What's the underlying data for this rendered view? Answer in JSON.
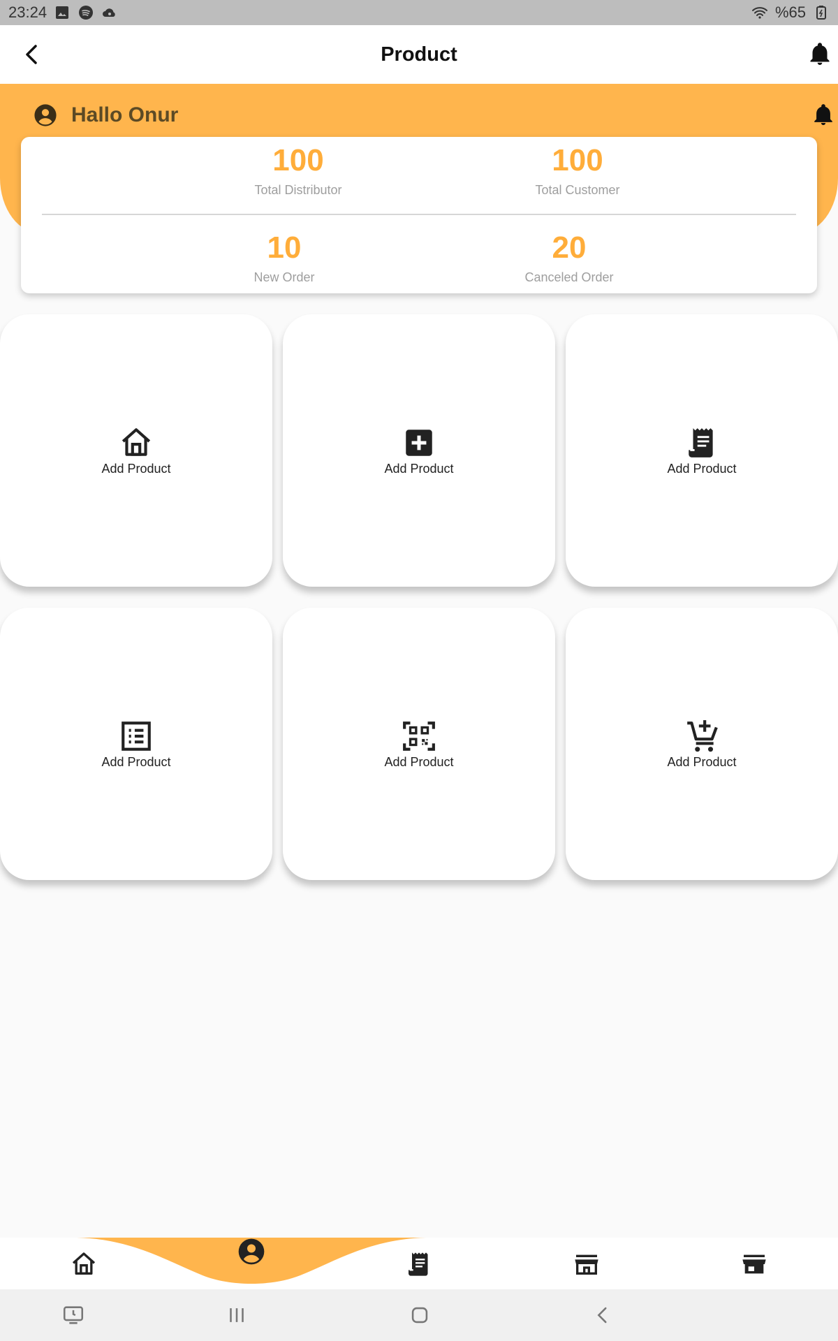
{
  "status_bar": {
    "time": "23:24",
    "battery": "%65",
    "icons": [
      "gallery-icon",
      "spotify-icon",
      "cloud-icon",
      "wifi-icon",
      "battery-icon"
    ]
  },
  "app_bar": {
    "title": "Product",
    "back_icon": "back-arrow-icon",
    "bell_icon": "bell-icon"
  },
  "header": {
    "greeting": "Hallo Onur",
    "avatar_icon": "account-circle-icon",
    "bell_icon": "bell-icon",
    "color": "#ffb54d"
  },
  "stats": [
    {
      "value": "100",
      "label": "Total Distributor"
    },
    {
      "value": "100",
      "label": "Total Customer"
    },
    {
      "value": "10",
      "label": "New Order"
    },
    {
      "value": "20",
      "label": "Canceled Order"
    }
  ],
  "tiles": [
    {
      "label": "Add Product",
      "icon": "home-icon"
    },
    {
      "label": "Add Product",
      "icon": "add-box-icon"
    },
    {
      "label": "Add Product",
      "icon": "receipt-icon"
    },
    {
      "label": "Add Product",
      "icon": "list-icon"
    },
    {
      "label": "Add Product",
      "icon": "qr-code-scanner-icon"
    },
    {
      "label": "Add Product",
      "icon": "add-shopping-cart-icon"
    }
  ],
  "bottom_nav": {
    "items": [
      "home-icon",
      "account-circle-icon",
      "receipt-icon",
      "store-outline-icon",
      "store-icon"
    ],
    "selected": "account-circle-icon"
  },
  "accent_color": "#ffad3a"
}
